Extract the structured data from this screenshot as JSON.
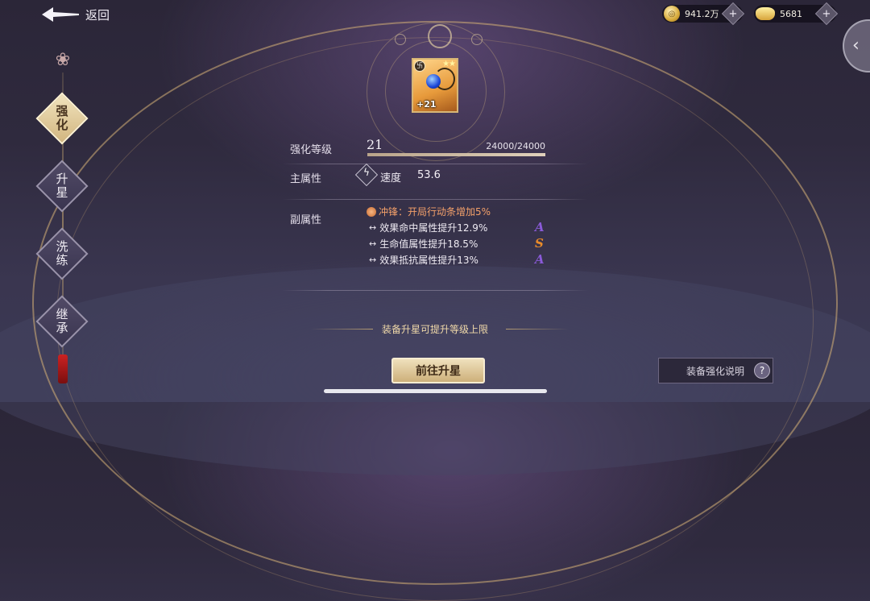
{
  "header": {
    "back_label": "返回",
    "currencies": [
      {
        "icon": "coin-icon",
        "value": "941.2万"
      },
      {
        "icon": "gold-ingot-icon",
        "value": "5681"
      }
    ]
  },
  "nav": {
    "items": [
      {
        "label_top": "强",
        "label_bottom": "化",
        "active": true
      },
      {
        "label_top": "升",
        "label_bottom": "星",
        "active": false
      },
      {
        "label_top": "洗",
        "label_bottom": "练",
        "active": false
      },
      {
        "label_top": "继",
        "label_bottom": "承",
        "active": false
      }
    ]
  },
  "equipment": {
    "level_badge": "+21",
    "stars": "★★",
    "corner_mark": "卐"
  },
  "stats": {
    "enhance_label": "强化等级",
    "enhance_level": "21",
    "exp_text": "24000/24000",
    "exp_progress": 1.0,
    "main_attr_label": "主属性",
    "main_attr_name": "速度",
    "main_attr_value": "53.6",
    "sub_attr_label": "副属性",
    "sub_attrs": [
      {
        "text": "冲锋：开局行动条增加5%",
        "type": "special",
        "grade": ""
      },
      {
        "text": "效果命中属性提升12.9%",
        "type": "normal",
        "grade": "A"
      },
      {
        "text": "生命值属性提升18.5%",
        "type": "normal",
        "grade": "S"
      },
      {
        "text": "效果抵抗属性提升13%",
        "type": "normal",
        "grade": "A"
      }
    ]
  },
  "hint": "装备升星可提升等级上限",
  "buttons": {
    "go_star": "前往升星",
    "explain": "装备强化说明",
    "explain_icon": "?"
  },
  "colors": {
    "accent_gold": "#d7b676",
    "special_attr": "#f3a06a",
    "grade_a": "#8a5ad8",
    "grade_s": "#e88a2a"
  }
}
